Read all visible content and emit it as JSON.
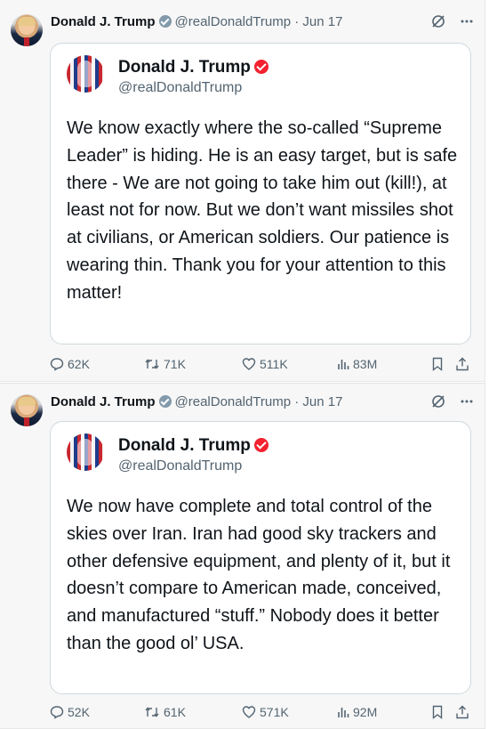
{
  "posts": [
    {
      "author_name": "Donald J. Trump",
      "handle": "@realDonaldTrump",
      "separator": "·",
      "date": "Jun 17",
      "quote": {
        "name": "Donald J. Trump",
        "handle": "@realDonaldTrump",
        "text": "We know exactly where the so-called “Supreme Leader” is hiding. He is an easy target, but is safe there - We are not going to take him out (kill!), at least not for now. But we don’t want missiles shot at civilians, or American soldiers. Our patience is wearing thin. Thank you for your attention to this matter!"
      },
      "stats": {
        "replies": "62K",
        "reposts": "71K",
        "likes": "511K",
        "views": "83M"
      }
    },
    {
      "author_name": "Donald J. Trump",
      "handle": "@realDonaldTrump",
      "separator": "·",
      "date": "Jun 17",
      "quote": {
        "name": "Donald J. Trump",
        "handle": "@realDonaldTrump",
        "text": "We now have complete and total control of the skies over Iran. Iran had good sky trackers and other defensive equipment, and plenty of it, but it doesn’t compare to American made, conceived, and manufactured “stuff.” Nobody does it better than the good ol’ USA."
      },
      "stats": {
        "replies": "52K",
        "reposts": "61K",
        "likes": "571K",
        "views": "92M"
      }
    }
  ],
  "icons": {
    "verified_author": "verified-badge-icon",
    "verified_quote": "verified-badge-icon",
    "grok": "grok-icon",
    "more": "more-icon",
    "reply": "reply-icon",
    "repost": "repost-icon",
    "like": "heart-icon",
    "views": "views-icon",
    "bookmark": "bookmark-icon",
    "share": "share-icon"
  },
  "colors": {
    "background": "#f7f7f7",
    "card": "#ffffff",
    "text": "#0f1419",
    "muted": "#536471",
    "badge_gray": "#829aab",
    "badge_red": "#f4212e"
  }
}
